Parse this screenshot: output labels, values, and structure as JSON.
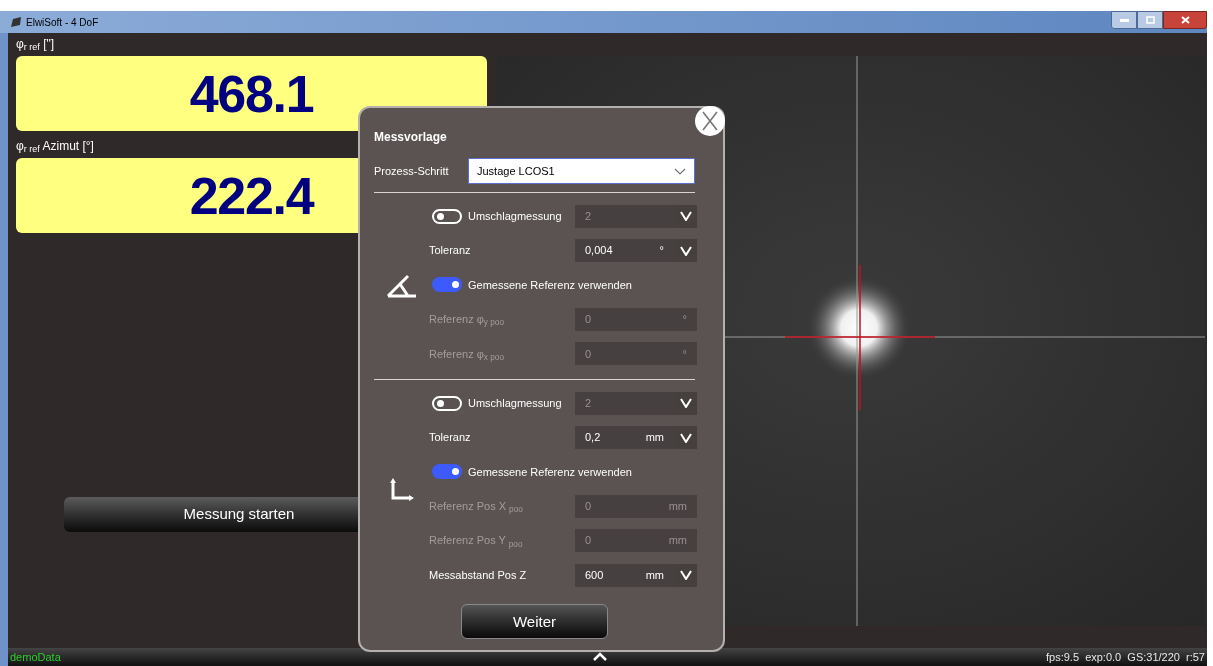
{
  "window": {
    "title": "ElwiSoft - 4 DoF"
  },
  "readouts": [
    {
      "label": "φ$_{r ref}$ [\"]",
      "value": "468.1"
    },
    {
      "label": "φ$_{r ref}$ Azimut [°]",
      "value": "222.4"
    }
  ],
  "start_button": "Messung starten",
  "dialog": {
    "title": "Messvorlage",
    "process_step": {
      "label": "Prozess-Schritt",
      "value": "Justage LCOS1"
    },
    "sections": [
      {
        "kind": "angle",
        "rows": [
          {
            "kind": "switch_field",
            "label": "Umschlagmessung",
            "on": false,
            "value": "2",
            "disabled": true,
            "dropdown": true
          },
          {
            "kind": "field",
            "label": "Toleranz",
            "value": "0,004",
            "unit": "°",
            "disabled": false,
            "dropdown": true
          },
          {
            "kind": "switch",
            "label": "Gemessene Referenz verwenden",
            "on": true
          },
          {
            "kind": "field",
            "label": "Referenz φ$_{y poo}$",
            "value": "0",
            "unit": "°",
            "disabled": true,
            "dropdown": false
          },
          {
            "kind": "field",
            "label": "Referenz φ$_{x poo}$",
            "value": "0",
            "unit": "°",
            "disabled": true,
            "dropdown": false
          }
        ]
      },
      {
        "kind": "position",
        "rows": [
          {
            "kind": "switch_field",
            "label": "Umschlagmessung",
            "on": false,
            "value": "2",
            "disabled": true,
            "dropdown": true
          },
          {
            "kind": "field",
            "label": "Toleranz",
            "value": "0,2",
            "unit": "mm",
            "disabled": false,
            "dropdown": true
          },
          {
            "kind": "switch",
            "label": "Gemessene Referenz verwenden",
            "on": true
          },
          {
            "kind": "field",
            "label": "Referenz Pos X $_{poo}$",
            "value": "0",
            "unit": "mm",
            "disabled": true,
            "dropdown": false
          },
          {
            "kind": "field",
            "label": "Referenz Pos Y $_{poo}$",
            "value": "0",
            "unit": "mm",
            "disabled": true,
            "dropdown": false
          },
          {
            "kind": "field",
            "label": "Messabstand Pos Z",
            "value": "600",
            "unit": "mm",
            "disabled": false,
            "dropdown": true
          }
        ]
      }
    ],
    "continue_button": "Weiter"
  },
  "status_bar": {
    "left": "demoData",
    "right": "fps:9.5  exp:0.0  GS:31/220  r:57"
  }
}
